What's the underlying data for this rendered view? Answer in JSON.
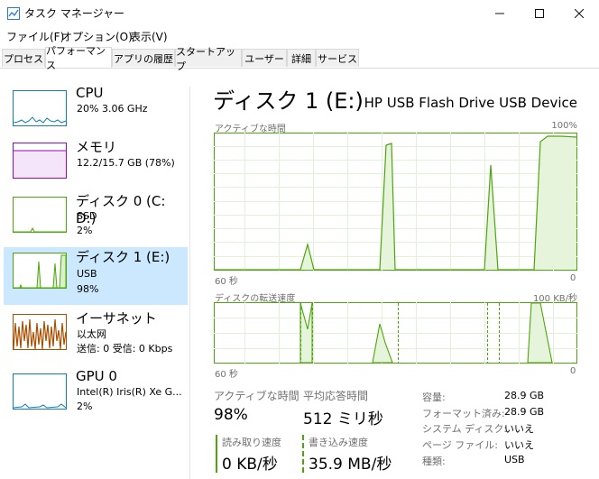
{
  "window": {
    "title": "タスク マネージャー"
  },
  "menu": {
    "file": "ファイル(F)",
    "options": "オプション(O)",
    "view": "表示(V)"
  },
  "tabs": [
    "プロセス",
    "パフォーマンス",
    "アプリの履歴",
    "スタートアップ",
    "ユーザー",
    "詳細",
    "サービス"
  ],
  "sidebar": {
    "items": [
      {
        "name": "CPU",
        "line1": "20%  3.06 GHz",
        "line2": "",
        "line3": ""
      },
      {
        "name": "メモリ",
        "line1": "12.2/15.7 GB (78%)",
        "line2": "",
        "line3": ""
      },
      {
        "name": "ディスク 0 (C: D:)",
        "line1": "SSD",
        "line2": "2%",
        "line3": ""
      },
      {
        "name": "ディスク 1 (E:)",
        "line1": "USB",
        "line2": "98%",
        "line3": ""
      },
      {
        "name": "イーサネット",
        "line1": "以太网",
        "line2": "送信: 0  受信: 0 Kbps",
        "line3": ""
      },
      {
        "name": "GPU 0",
        "line1": "Intel(R) Iris(R) Xe G...",
        "line2": "2%",
        "line3": ""
      }
    ]
  },
  "main": {
    "title": "ディスク 1 (E:)",
    "device": "HP USB Flash Drive USB Device",
    "graph1": {
      "label": "アクティブな時間",
      "max": "100%",
      "xleft": "60 秒",
      "xright": "0"
    },
    "graph2": {
      "label": "ディスクの転送速度",
      "max": "100 KB/秒",
      "xleft": "60 秒",
      "xright": "0"
    },
    "stats": {
      "active_label": "アクティブな時間",
      "active_value": "98%",
      "resp_label": "平均応答時間",
      "resp_value": "512 ミリ秒",
      "read_label": "読み取り速度",
      "read_value": "0 KB/秒",
      "write_label": "書き込み速度",
      "write_value": "35.9 MB/秒"
    },
    "props": [
      {
        "label": "容量:",
        "value": "28.9 GB"
      },
      {
        "label": "フォーマット済み:",
        "value": "28.9 GB"
      },
      {
        "label": "システム ディスク:",
        "value": "いいえ"
      },
      {
        "label": "ページ ファイル:",
        "value": "いいえ"
      },
      {
        "label": "種類:",
        "value": "USB"
      }
    ]
  },
  "colors": {
    "disk": "#4da60c",
    "cpu": "#117dbb",
    "memory": "#8b12ae",
    "ethernet": "#a74f01",
    "selected": "#cce8ff"
  }
}
